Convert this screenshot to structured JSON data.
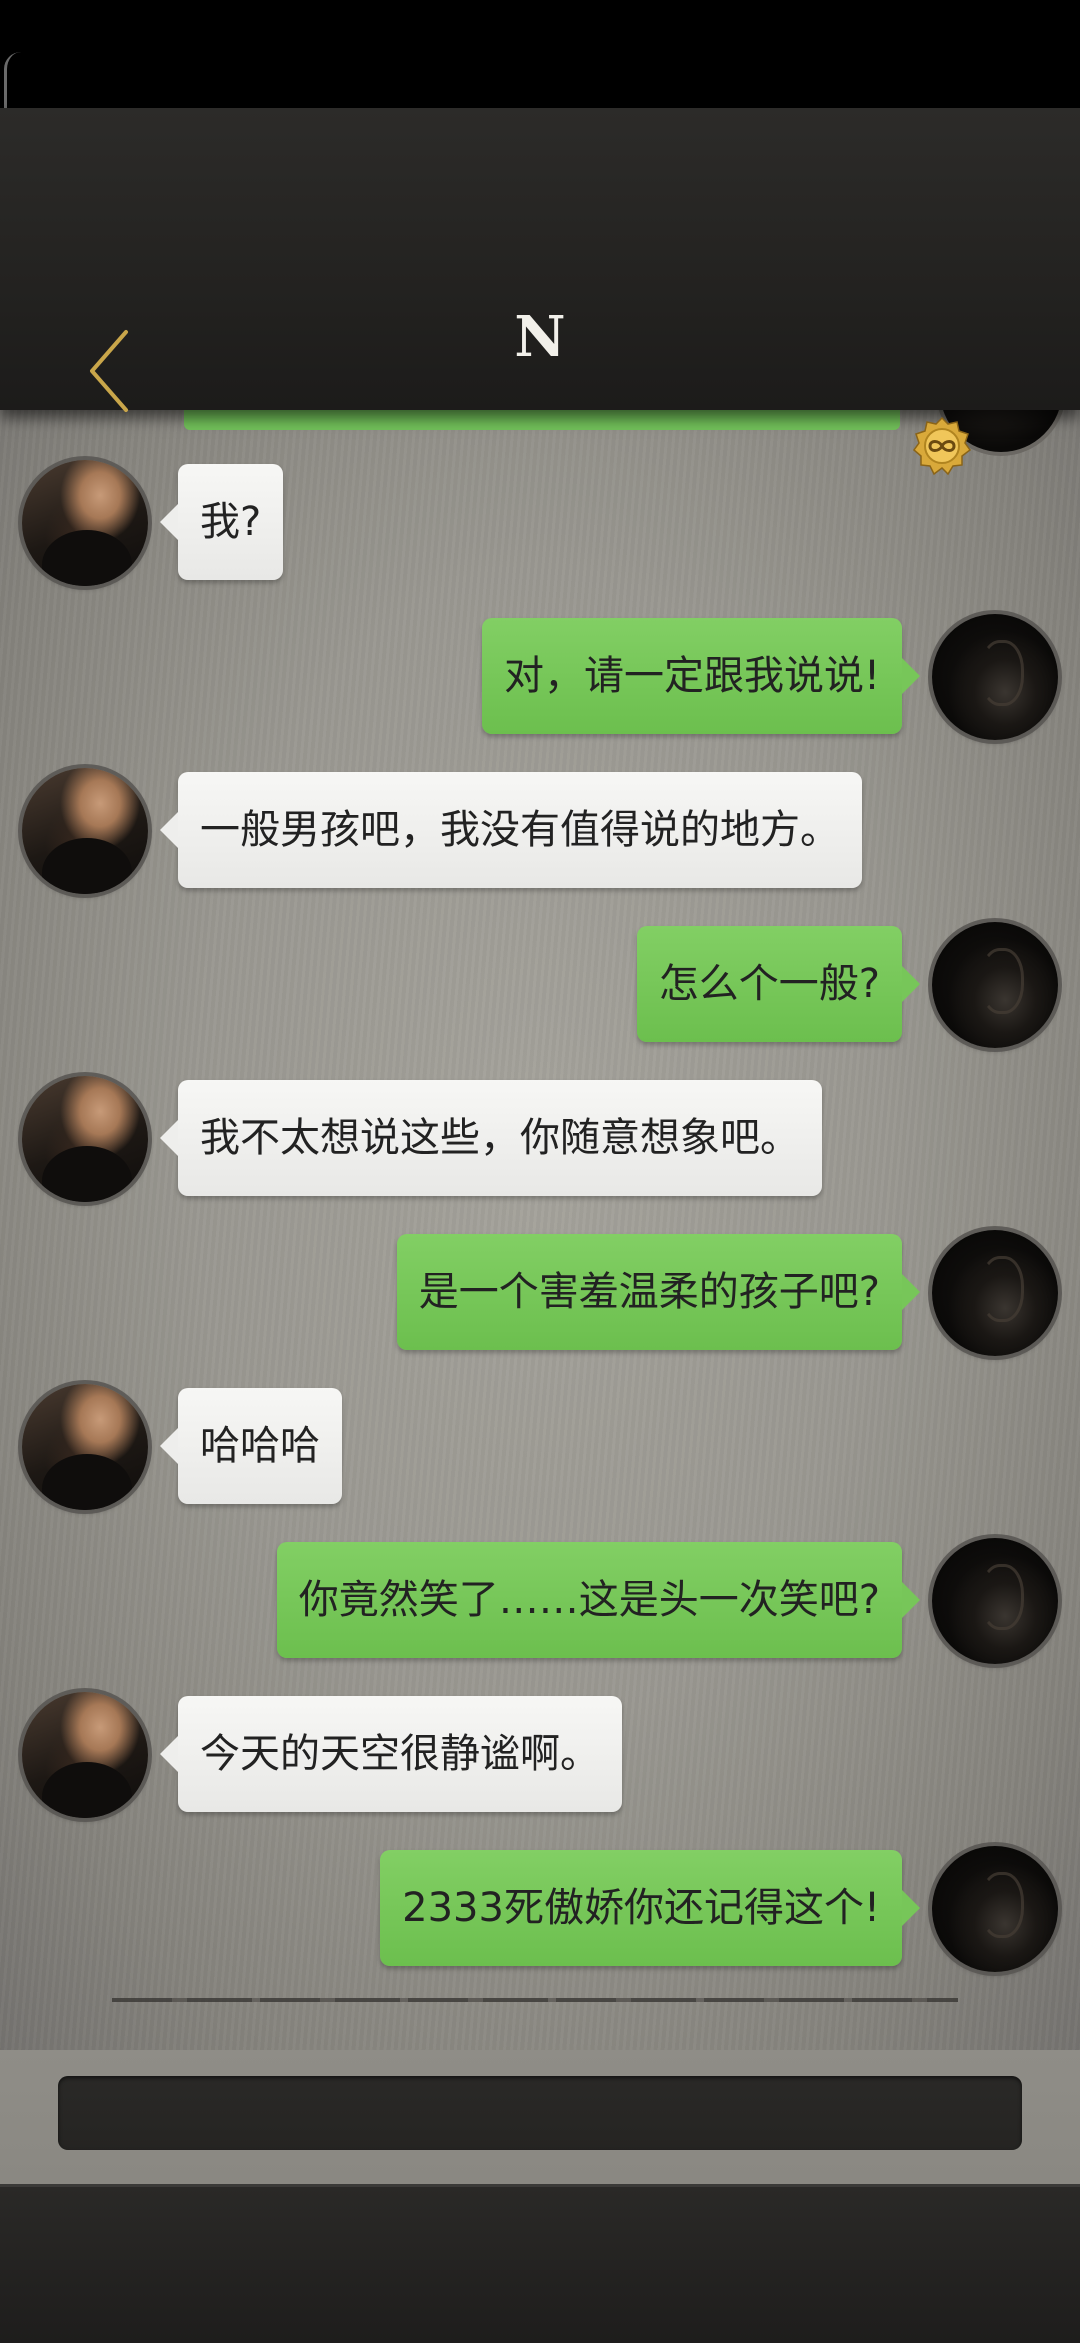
{
  "header": {
    "title": "N",
    "back_icon": "chevron-left-icon",
    "badge_icon": "infinity-coin-icon",
    "accent_color": "#c9a64a"
  },
  "messages": [
    {
      "side": "left",
      "text": "我?"
    },
    {
      "side": "right",
      "text": "对，请一定跟我说说!"
    },
    {
      "side": "left",
      "text": "一般男孩吧，我没有值得说的地方。"
    },
    {
      "side": "right",
      "text": "怎么个一般?"
    },
    {
      "side": "left",
      "text": "我不太想说这些，你随意想象吧。"
    },
    {
      "side": "right",
      "text": "是一个害羞温柔的孩子吧?"
    },
    {
      "side": "left",
      "text": "哈哈哈"
    },
    {
      "side": "right",
      "text": "你竟然笑了……这是头一次笑吧?"
    },
    {
      "side": "left",
      "text": "今天的天空很静谧啊。"
    },
    {
      "side": "right",
      "text": "2333死傲娇你还记得这个!"
    }
  ],
  "colors": {
    "outgoing_bubble": "#74c557",
    "incoming_bubble": "#f0f0ee"
  }
}
